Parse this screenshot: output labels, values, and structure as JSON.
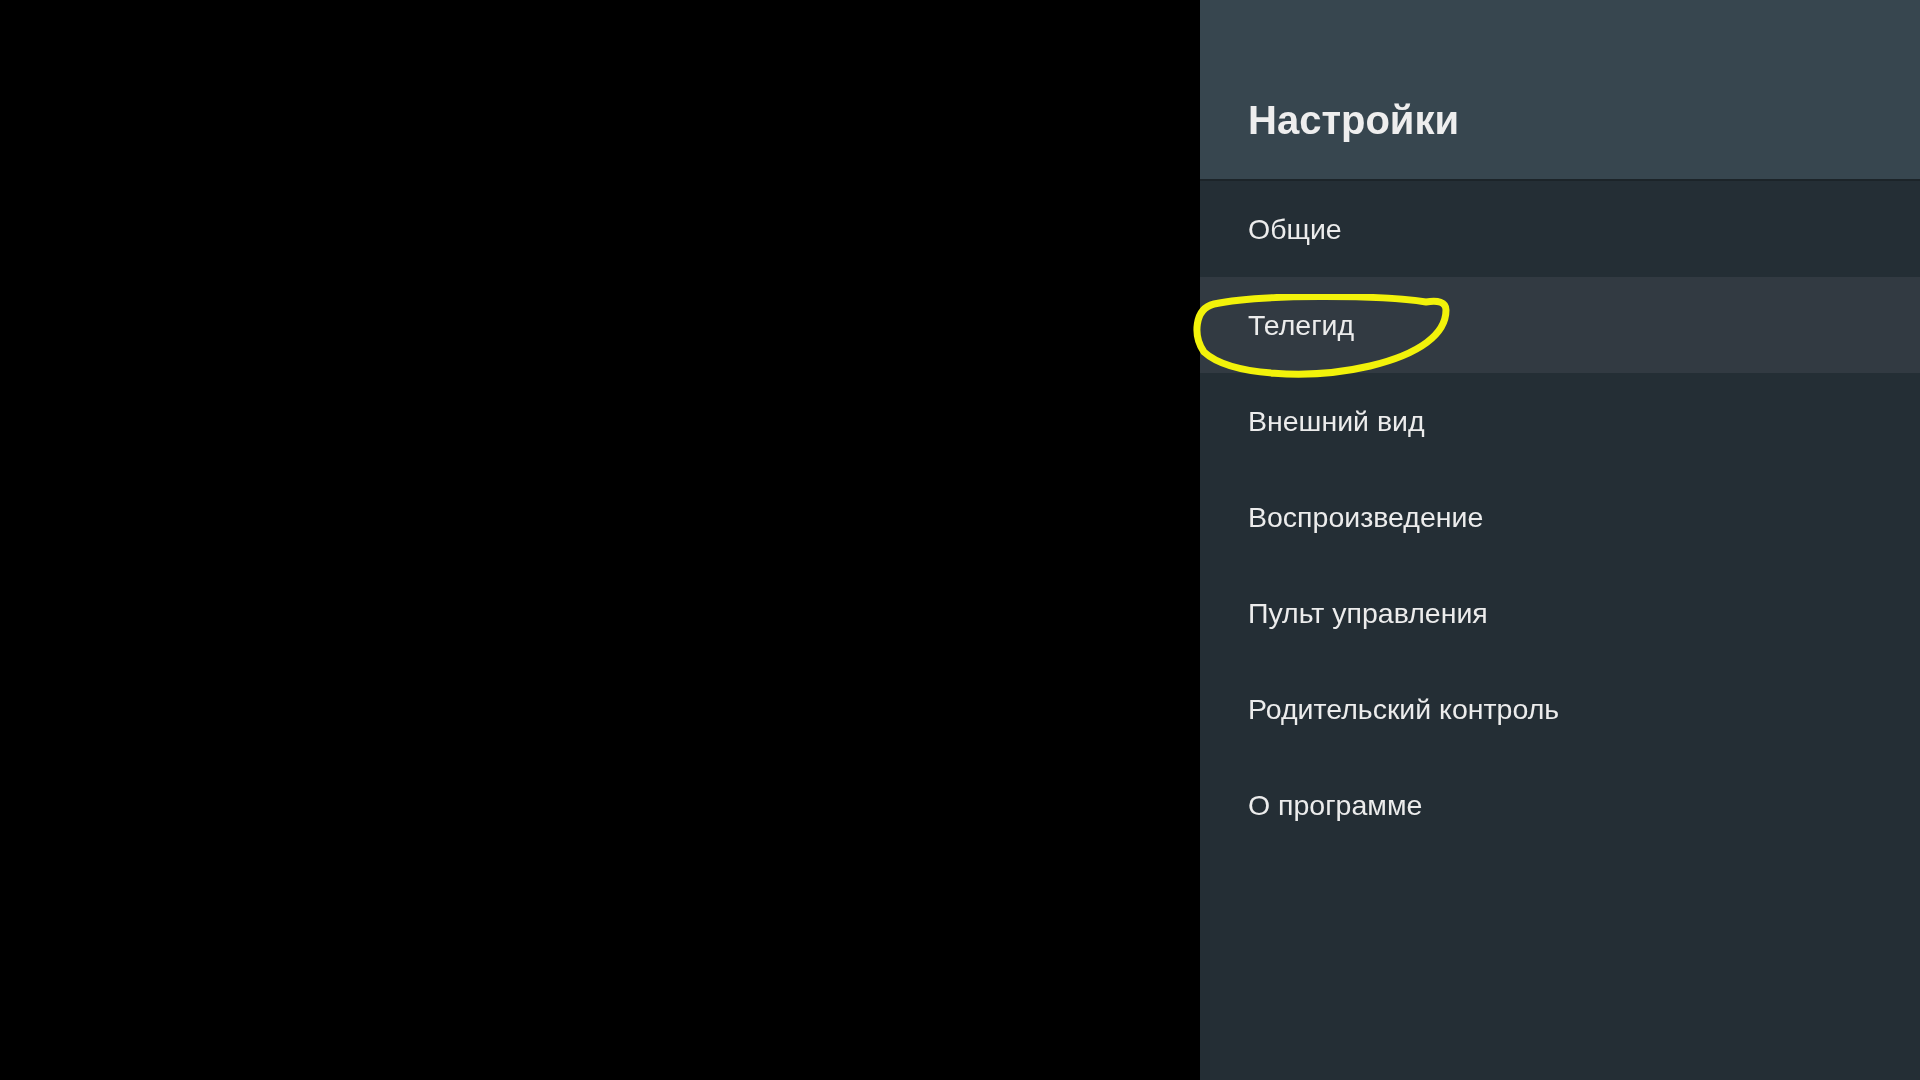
{
  "settings_panel": {
    "title": "Настройки",
    "items": [
      {
        "label": "Общие",
        "selected": false
      },
      {
        "label": "Телегид",
        "selected": true
      },
      {
        "label": "Внешний вид",
        "selected": false
      },
      {
        "label": "Воспроизведение",
        "selected": false
      },
      {
        "label": "Пульт управления",
        "selected": false
      },
      {
        "label": "Родительский контроль",
        "selected": false
      },
      {
        "label": "О программе",
        "selected": false
      }
    ]
  }
}
